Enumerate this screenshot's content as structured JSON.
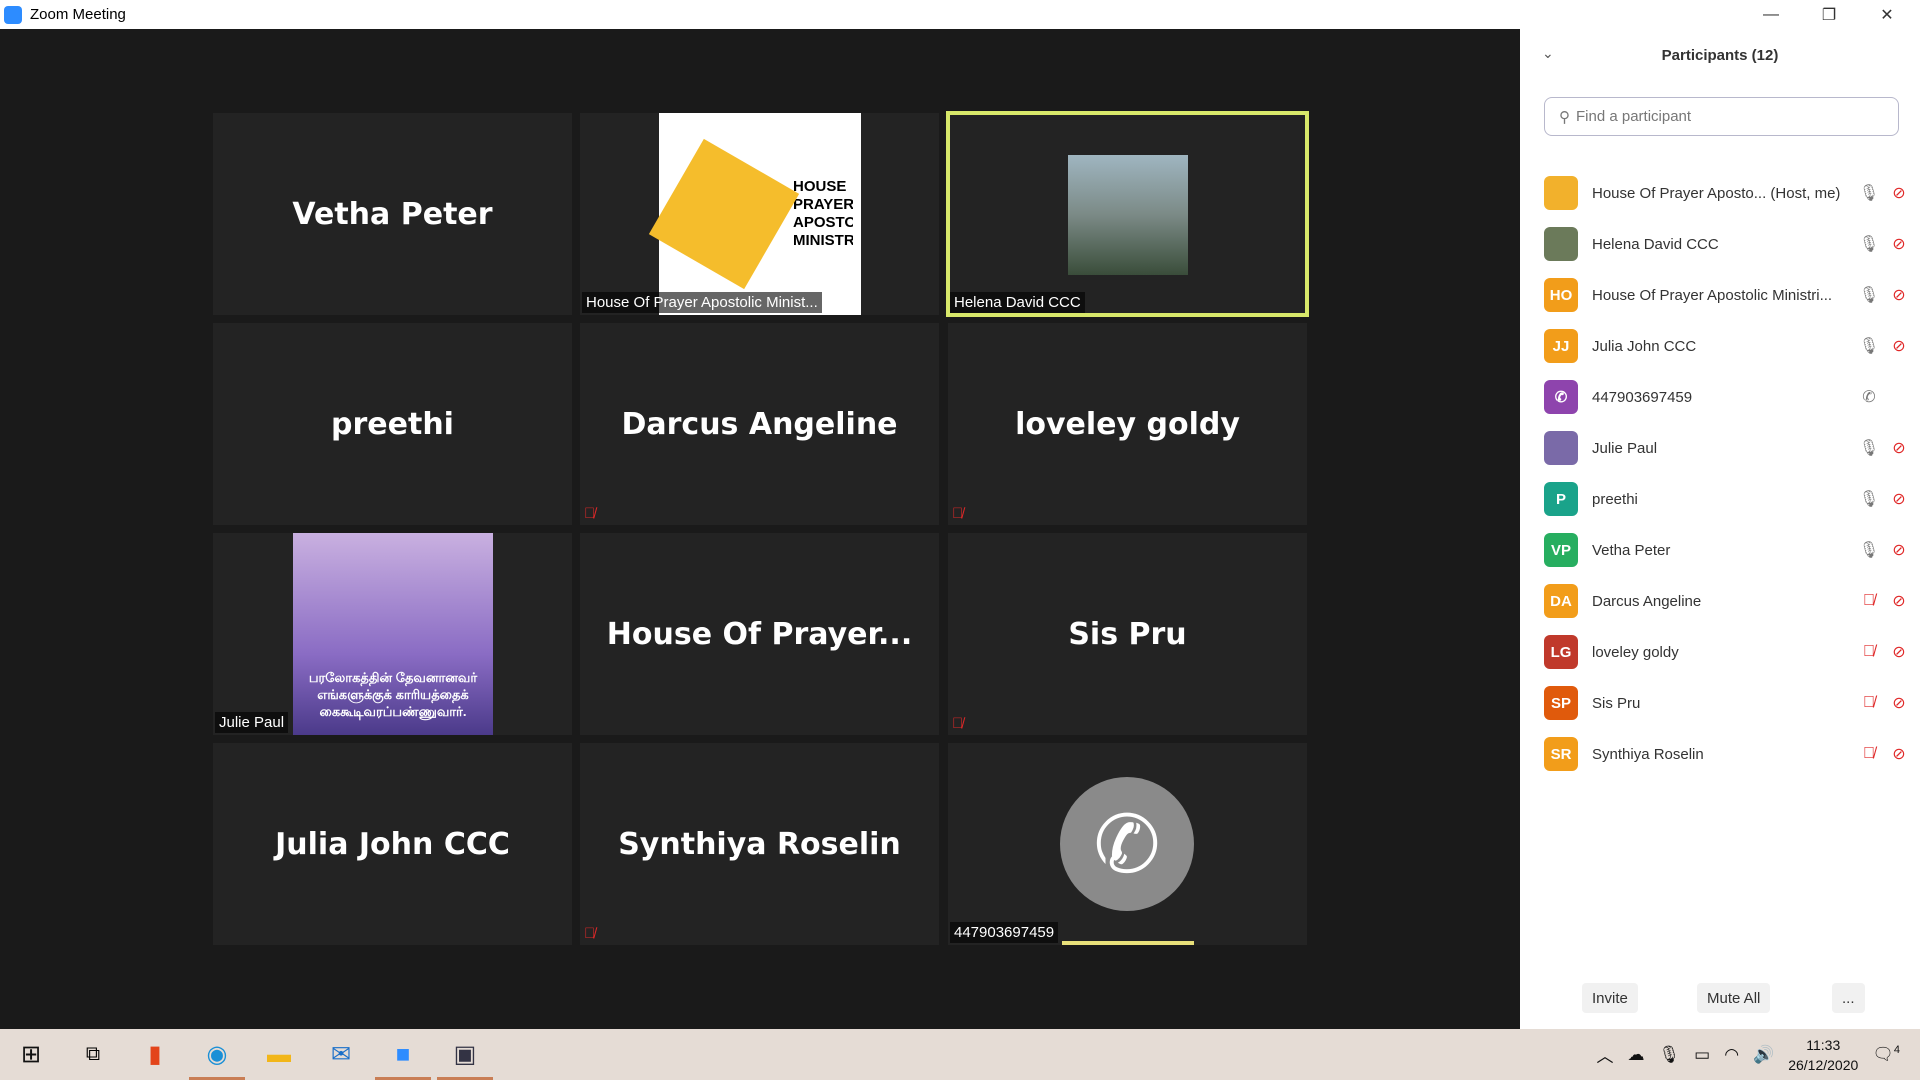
{
  "window": {
    "title": "Zoom Meeting",
    "minimize": "—",
    "restore": "❐",
    "close": "✕"
  },
  "tiles": [
    {
      "name": "Vetha Peter",
      "label": ""
    },
    {
      "name": "",
      "label": "House Of Prayer Apostolic Minist...",
      "logo_text": "HOUSE PRAYER APOSTO MINISTR"
    },
    {
      "name": "",
      "label": "Helena David CCC",
      "active": true
    },
    {
      "name": "preethi",
      "label": ""
    },
    {
      "name": "Darcus Angeline",
      "label": "",
      "muted": true
    },
    {
      "name": "loveley goldy",
      "label": "",
      "muted": true
    },
    {
      "name": "",
      "label": "Julie Paul",
      "image_text": "பரலோகத்தின் தேவனானவர் எங்களுக்குக் காரியத்தைக் கைகூடிவரப்பண்ணுவார்."
    },
    {
      "name": "House Of Prayer...",
      "label": ""
    },
    {
      "name": "Sis Pru",
      "label": "",
      "muted": true
    },
    {
      "name": "Julia John CCC",
      "label": ""
    },
    {
      "name": "Synthiya Roselin",
      "label": "",
      "muted": true
    },
    {
      "name": "",
      "label": "447903697459",
      "phone": true
    }
  ],
  "panel": {
    "title": "Participants (12)",
    "search_placeholder": "Find a participant",
    "participants": [
      {
        "name": "House Of Prayer Aposto... (Host, me)",
        "initials": "",
        "color": "#f2b12c",
        "mic": "on",
        "video": "off"
      },
      {
        "name": "Helena David CCC",
        "initials": "",
        "color": "#6b7a5a",
        "mic": "on",
        "video": "off"
      },
      {
        "name": "House Of Prayer Apostolic Ministri...",
        "initials": "HO",
        "color": "#f29d1a",
        "mic": "on",
        "video": "off"
      },
      {
        "name": "Julia John CCC",
        "initials": "JJ",
        "color": "#f29d1a",
        "mic": "on",
        "video": "off"
      },
      {
        "name": "447903697459",
        "initials": "✆",
        "color": "#8e44ad",
        "mic": "phone",
        "video": ""
      },
      {
        "name": "Julie Paul",
        "initials": "",
        "color": "#7a6aa8",
        "mic": "on",
        "video": "off"
      },
      {
        "name": "preethi",
        "initials": "P",
        "color": "#1aa38a",
        "mic": "on",
        "video": "off"
      },
      {
        "name": "Vetha Peter",
        "initials": "VP",
        "color": "#27ae60",
        "mic": "on",
        "video": "off"
      },
      {
        "name": "Darcus Angeline",
        "initials": "DA",
        "color": "#f29d1a",
        "mic": "off",
        "video": "off"
      },
      {
        "name": "loveley goldy",
        "initials": "LG",
        "color": "#c0392b",
        "mic": "off",
        "video": "off"
      },
      {
        "name": "Sis Pru",
        "initials": "SP",
        "color": "#e05a0c",
        "mic": "off",
        "video": "off"
      },
      {
        "name": "Synthiya Roselin",
        "initials": "SR",
        "color": "#f29d1a",
        "mic": "off",
        "video": "off"
      }
    ],
    "invite": "Invite",
    "mute_all": "Mute All",
    "more": "..."
  },
  "taskbar": {
    "time": "11:33",
    "date": "26/12/2020",
    "notifications": "4"
  }
}
